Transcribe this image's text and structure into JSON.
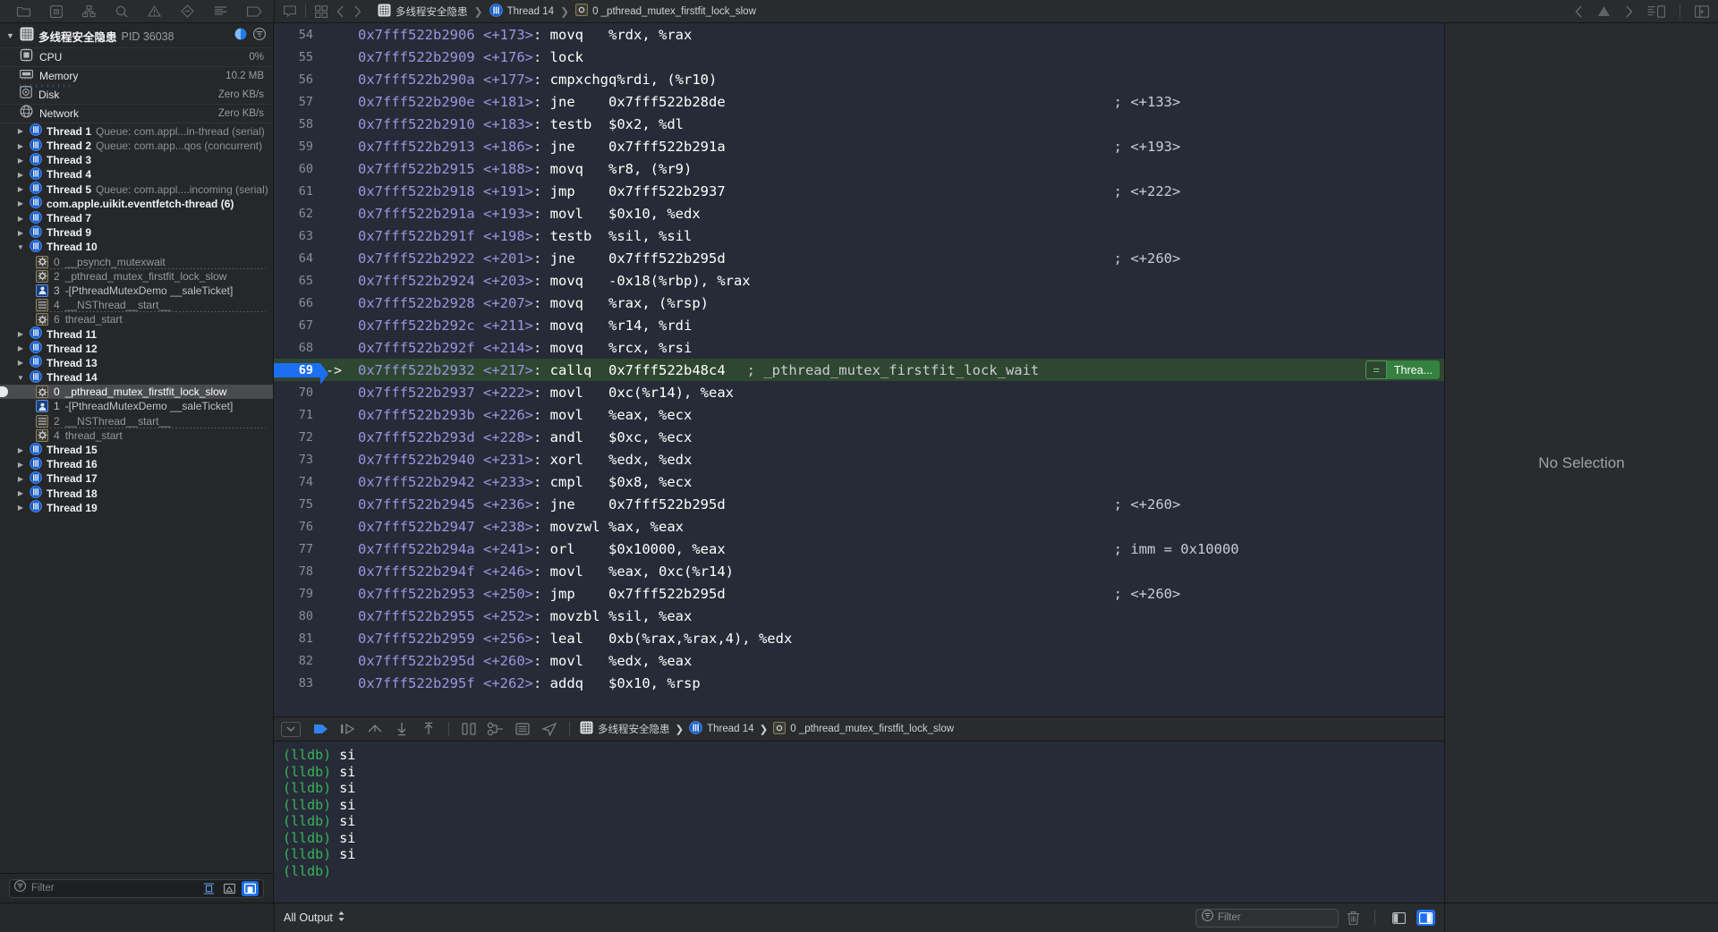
{
  "toolbar": {
    "icons": [
      {
        "name": "folder-icon",
        "label": "Project navigator"
      },
      {
        "name": "source-control-icon",
        "label": "Source control navigator"
      },
      {
        "name": "symbol-navigator-icon",
        "label": "Symbol navigator"
      },
      {
        "name": "search-icon",
        "label": "Find navigator"
      },
      {
        "name": "warning-icon",
        "label": "Issue navigator"
      },
      {
        "name": "test-navigator-icon",
        "label": "Test navigator"
      },
      {
        "name": "debug-navigator-icon",
        "label": "Debug navigator"
      },
      {
        "name": "breakpoint-navigator-icon",
        "label": "Breakpoint navigator"
      }
    ]
  },
  "jumpbar": {
    "project": "多线程安全隐患",
    "thread": "Thread 14",
    "frame": "0 _pthread_mutex_firstfit_lock_slow",
    "related_items_icon": "related-items-icon",
    "back_icon": "chevron-left-icon",
    "forward_icon": "chevron-right-icon",
    "warning_icon": "warning-triangle-icon"
  },
  "navigator": {
    "process": {
      "name": "多线程安全隐患",
      "pid_label": "PID 36038",
      "cpu_badge_icon": "view-cpu-icon",
      "filter_badge_icon": "filter-circle-icon"
    },
    "gauges": [
      {
        "label": "CPU",
        "value": "0%",
        "icon": "cpu-icon"
      },
      {
        "label": "Memory",
        "value": "10.2 MB",
        "icon": "memory-icon"
      },
      {
        "label": "Disk",
        "value": "Zero KB/s",
        "icon": "disk-icon"
      },
      {
        "label": "Network",
        "value": "Zero KB/s",
        "icon": "network-icon"
      }
    ],
    "threads": [
      {
        "name": "Thread 1",
        "queue": "Queue: com.appl...in-thread (serial)",
        "expanded": false
      },
      {
        "name": "Thread 2",
        "queue": "Queue: com.app...qos (concurrent)",
        "expanded": false
      },
      {
        "name": "Thread 3",
        "queue": "",
        "expanded": false
      },
      {
        "name": "Thread 4",
        "queue": "",
        "expanded": false
      },
      {
        "name": "Thread 5",
        "queue": "Queue: com.appl....incoming (serial)",
        "expanded": false
      },
      {
        "name": "com.apple.uikit.eventfetch-thread (6)",
        "queue": "",
        "expanded": false
      },
      {
        "name": "Thread 7",
        "queue": "",
        "expanded": false
      },
      {
        "name": "Thread 9",
        "queue": "",
        "expanded": false
      },
      {
        "name": "Thread 10",
        "queue": "",
        "expanded": true,
        "frames": [
          {
            "num": "0",
            "symbol": "__psynch_mutexwait",
            "kind": "sys",
            "selected": false,
            "dim": true,
            "rule": true
          },
          {
            "num": "2",
            "symbol": "_pthread_mutex_firstfit_lock_slow",
            "kind": "sys",
            "selected": false,
            "dim": true,
            "rule": false
          },
          {
            "num": "3",
            "symbol": "-[PthreadMutexDemo __saleTicket]",
            "kind": "user",
            "selected": false,
            "dim": false,
            "rule": false
          },
          {
            "num": "4",
            "symbol": "__NSThread__start__",
            "kind": "obj",
            "selected": false,
            "dim": true,
            "rule": true
          },
          {
            "num": "6",
            "symbol": "thread_start",
            "kind": "sys",
            "selected": false,
            "dim": true,
            "rule": false
          }
        ]
      },
      {
        "name": "Thread 11",
        "queue": "",
        "expanded": false
      },
      {
        "name": "Thread 12",
        "queue": "",
        "expanded": false
      },
      {
        "name": "Thread 13",
        "queue": "",
        "expanded": false
      },
      {
        "name": "Thread 14",
        "queue": "",
        "expanded": true,
        "frames": [
          {
            "num": "0",
            "symbol": "_pthread_mutex_firstfit_lock_slow",
            "kind": "sys",
            "selected": true,
            "dim": false,
            "rule": false
          },
          {
            "num": "1",
            "symbol": "-[PthreadMutexDemo __saleTicket]",
            "kind": "user",
            "selected": false,
            "dim": false,
            "rule": false
          },
          {
            "num": "2",
            "symbol": "__NSThread__start__",
            "kind": "obj",
            "selected": false,
            "dim": true,
            "rule": true
          },
          {
            "num": "4",
            "symbol": "thread_start",
            "kind": "sys",
            "selected": false,
            "dim": true,
            "rule": false
          }
        ]
      },
      {
        "name": "Thread 15",
        "queue": "",
        "expanded": false
      },
      {
        "name": "Thread 16",
        "queue": "",
        "expanded": false
      },
      {
        "name": "Thread 17",
        "queue": "",
        "expanded": false
      },
      {
        "name": "Thread 18",
        "queue": "",
        "expanded": false
      },
      {
        "name": "Thread 19",
        "queue": "",
        "expanded": false
      }
    ],
    "filter": {
      "placeholder": "Filter",
      "buttons": [
        {
          "name": "show-only-stack-frames-button",
          "active": false
        },
        {
          "name": "show-only-crashed-threads-button",
          "active": false
        },
        {
          "name": "show-only-relevant-frames-button",
          "active": true
        }
      ]
    }
  },
  "code": {
    "current_line": 69,
    "thread_pill": {
      "eq": "=",
      "text": "Threa..."
    },
    "lines": [
      {
        "n": "54",
        "addr": "0x7fff522b2906",
        "off": "<+173>",
        "mn": "movq",
        "ops": "%rdx, %rax",
        "comment": ""
      },
      {
        "n": "55",
        "addr": "0x7fff522b2909",
        "off": "<+176>",
        "mn": "lock",
        "ops": "",
        "comment": ""
      },
      {
        "n": "56",
        "addr": "0x7fff522b290a",
        "off": "<+177>",
        "mn": "cmpxchgq",
        "ops": "%rdi, (%r10)",
        "comment": ""
      },
      {
        "n": "57",
        "addr": "0x7fff522b290e",
        "off": "<+181>",
        "mn": "jne",
        "ops": "0x7fff522b28de",
        "comment": "; <+133>"
      },
      {
        "n": "58",
        "addr": "0x7fff522b2910",
        "off": "<+183>",
        "mn": "testb",
        "ops": "$0x2, %dl",
        "comment": ""
      },
      {
        "n": "59",
        "addr": "0x7fff522b2913",
        "off": "<+186>",
        "mn": "jne",
        "ops": "0x7fff522b291a",
        "comment": "; <+193>"
      },
      {
        "n": "60",
        "addr": "0x7fff522b2915",
        "off": "<+188>",
        "mn": "movq",
        "ops": "%r8, (%r9)",
        "comment": ""
      },
      {
        "n": "61",
        "addr": "0x7fff522b2918",
        "off": "<+191>",
        "mn": "jmp",
        "ops": "0x7fff522b2937",
        "comment": "; <+222>"
      },
      {
        "n": "62",
        "addr": "0x7fff522b291a",
        "off": "<+193>",
        "mn": "movl",
        "ops": "$0x10, %edx",
        "comment": ""
      },
      {
        "n": "63",
        "addr": "0x7fff522b291f",
        "off": "<+198>",
        "mn": "testb",
        "ops": "%sil, %sil",
        "comment": ""
      },
      {
        "n": "64",
        "addr": "0x7fff522b2922",
        "off": "<+201>",
        "mn": "jne",
        "ops": "0x7fff522b295d",
        "comment": "; <+260>"
      },
      {
        "n": "65",
        "addr": "0x7fff522b2924",
        "off": "<+203>",
        "mn": "movq",
        "ops": "-0x18(%rbp), %rax",
        "comment": ""
      },
      {
        "n": "66",
        "addr": "0x7fff522b2928",
        "off": "<+207>",
        "mn": "movq",
        "ops": "%rax, (%rsp)",
        "comment": ""
      },
      {
        "n": "67",
        "addr": "0x7fff522b292c",
        "off": "<+211>",
        "mn": "movq",
        "ops": "%r14, %rdi",
        "comment": ""
      },
      {
        "n": "68",
        "addr": "0x7fff522b292f",
        "off": "<+214>",
        "mn": "movq",
        "ops": "%rcx, %rsi",
        "comment": ""
      },
      {
        "n": "69",
        "addr": "0x7fff522b2932",
        "off": "<+217>",
        "mn": "callq",
        "ops": "0x7fff522b48c4",
        "comment": "; _pthread_mutex_firstfit_lock_wait",
        "current": true,
        "arrow": "->"
      },
      {
        "n": "70",
        "addr": "0x7fff522b2937",
        "off": "<+222>",
        "mn": "movl",
        "ops": "0xc(%r14), %eax",
        "comment": ""
      },
      {
        "n": "71",
        "addr": "0x7fff522b293b",
        "off": "<+226>",
        "mn": "movl",
        "ops": "%eax, %ecx",
        "comment": ""
      },
      {
        "n": "72",
        "addr": "0x7fff522b293d",
        "off": "<+228>",
        "mn": "andl",
        "ops": "$0xc, %ecx",
        "comment": ""
      },
      {
        "n": "73",
        "addr": "0x7fff522b2940",
        "off": "<+231>",
        "mn": "xorl",
        "ops": "%edx, %edx",
        "comment": ""
      },
      {
        "n": "74",
        "addr": "0x7fff522b2942",
        "off": "<+233>",
        "mn": "cmpl",
        "ops": "$0x8, %ecx",
        "comment": ""
      },
      {
        "n": "75",
        "addr": "0x7fff522b2945",
        "off": "<+236>",
        "mn": "jne",
        "ops": "0x7fff522b295d",
        "comment": "; <+260>"
      },
      {
        "n": "76",
        "addr": "0x7fff522b2947",
        "off": "<+238>",
        "mn": "movzwl",
        "ops": "%ax, %eax",
        "comment": ""
      },
      {
        "n": "77",
        "addr": "0x7fff522b294a",
        "off": "<+241>",
        "mn": "orl",
        "ops": "$0x10000, %eax",
        "comment": "; imm = 0x10000"
      },
      {
        "n": "78",
        "addr": "0x7fff522b294f",
        "off": "<+246>",
        "mn": "movl",
        "ops": "%eax, 0xc(%r14)",
        "comment": ""
      },
      {
        "n": "79",
        "addr": "0x7fff522b2953",
        "off": "<+250>",
        "mn": "jmp",
        "ops": "0x7fff522b295d",
        "comment": "; <+260>"
      },
      {
        "n": "80",
        "addr": "0x7fff522b2955",
        "off": "<+252>",
        "mn": "movzbl",
        "ops": "%sil, %eax",
        "comment": ""
      },
      {
        "n": "81",
        "addr": "0x7fff522b2959",
        "off": "<+256>",
        "mn": "leal",
        "ops": "0xb(%rax,%rax,4), %edx",
        "comment": ""
      },
      {
        "n": "82",
        "addr": "0x7fff522b295d",
        "off": "<+260>",
        "mn": "movl",
        "ops": "%edx, %eax",
        "comment": ""
      },
      {
        "n": "83",
        "addr": "0x7fff522b295f",
        "off": "<+262>",
        "mn": "addq",
        "ops": "$0x10, %rsp",
        "comment": ""
      }
    ]
  },
  "debugbar": {
    "buttons": [
      {
        "name": "hide-debug-area-button"
      },
      {
        "name": "continue-button"
      },
      {
        "name": "step-over-button"
      },
      {
        "name": "step-into-button"
      },
      {
        "name": "step-out-button"
      },
      {
        "name": "step-out-of-frame-button"
      },
      {
        "name": "debug-view-hierarchy-button"
      },
      {
        "name": "debug-memory-graph-button"
      },
      {
        "name": "environment-overrides-button"
      },
      {
        "name": "simulate-location-button"
      }
    ],
    "jumpbar": {
      "project": "多线程安全隐患",
      "thread": "Thread 14",
      "frame": "0 _pthread_mutex_firstfit_lock_slow"
    }
  },
  "console": {
    "lines": [
      {
        "prompt": "(lldb)",
        "cmd": "si"
      },
      {
        "prompt": "(lldb)",
        "cmd": "si"
      },
      {
        "prompt": "(lldb)",
        "cmd": "si"
      },
      {
        "prompt": "(lldb)",
        "cmd": "si"
      },
      {
        "prompt": "(lldb)",
        "cmd": "si"
      },
      {
        "prompt": "(lldb)",
        "cmd": "si"
      },
      {
        "prompt": "(lldb)",
        "cmd": "si"
      },
      {
        "prompt": "(lldb)",
        "cmd": ""
      }
    ]
  },
  "inspector": {
    "empty_text": "No Selection"
  },
  "statusbar": {
    "output_scope": "All Output",
    "console_filter_placeholder": "Filter",
    "trash_icon": "trash-icon",
    "panes": [
      {
        "name": "toggle-console-pane-button",
        "active": false
      },
      {
        "name": "toggle-variables-pane-button",
        "active": true
      }
    ]
  },
  "colors": {
    "accent": "#1c6ef2",
    "current_line_bg": "#2f4630",
    "thread_pill": "#35813f",
    "code_bg": "#262b37",
    "chrome_bg": "#2a2b2d",
    "navigator_bg": "#262729"
  }
}
